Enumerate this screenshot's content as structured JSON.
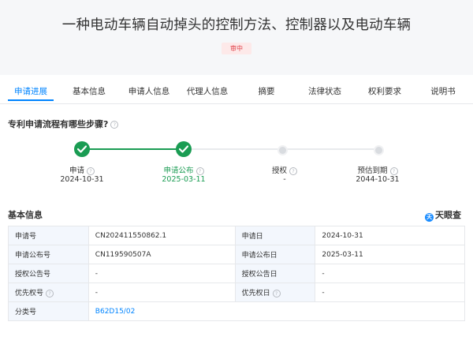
{
  "header": {
    "title": "一种电动车辆自动掉头的控制方法、控制器以及电动车辆",
    "status": "审中"
  },
  "tabs": [
    "申请进展",
    "基本信息",
    "申请人信息",
    "代理人信息",
    "摘要",
    "法律状态",
    "权利要求",
    "说明书"
  ],
  "progress": {
    "title": "专利申请流程有哪些步骤?",
    "steps": [
      {
        "label": "申请",
        "date": "2024-10-31",
        "state": "done",
        "has_help": true
      },
      {
        "label": "申请公布",
        "date": "2025-03-11",
        "state": "done",
        "has_help": true
      },
      {
        "label": "授权",
        "date": "-",
        "state": "pending",
        "has_help": true
      },
      {
        "label": "预估到期",
        "date": "2044-10-31",
        "state": "pending",
        "has_help": true
      }
    ]
  },
  "basic_info": {
    "title": "基本信息",
    "brand": "天眼查",
    "rows": [
      {
        "k1": "申请号",
        "v1": "CN202411550862.1",
        "k2": "申请日",
        "v2": "2024-10-31"
      },
      {
        "k1": "申请公布号",
        "v1": "CN119590507A",
        "k2": "申请公布日",
        "v2": "2025-03-11"
      },
      {
        "k1": "授权公告号",
        "v1": "-",
        "k2": "授权公告日",
        "v2": "-"
      },
      {
        "k1": "优先权号",
        "v1": "-",
        "k2": "优先权日",
        "v2": "-"
      },
      {
        "k1": "分类号",
        "v1": "B62D15/02"
      }
    ]
  },
  "colors": {
    "accent": "#0084ff",
    "done": "#1a9c53",
    "danger": "#e0424a"
  }
}
